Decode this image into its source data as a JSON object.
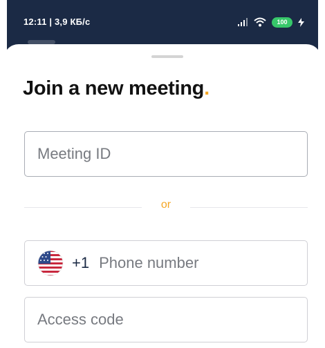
{
  "status_bar": {
    "time_speed": "12:11 | 3,9 КБ/с",
    "battery": "100",
    "signal_icon": "signal-icon",
    "wifi_icon": "wifi-icon",
    "charging_icon": "bolt-icon",
    "background_color": "#1b2a45",
    "battery_color": "#37c76a"
  },
  "sheet": {
    "title": "Join a new meeting",
    "title_dot": ".",
    "accent_color": "#f5a623"
  },
  "meeting_id": {
    "placeholder": "Meeting ID"
  },
  "divider": {
    "text": "or"
  },
  "phone": {
    "flag_icon": "us-flag-icon",
    "country_code": "+1",
    "placeholder": "Phone number"
  },
  "access_code": {
    "placeholder": "Access code"
  }
}
